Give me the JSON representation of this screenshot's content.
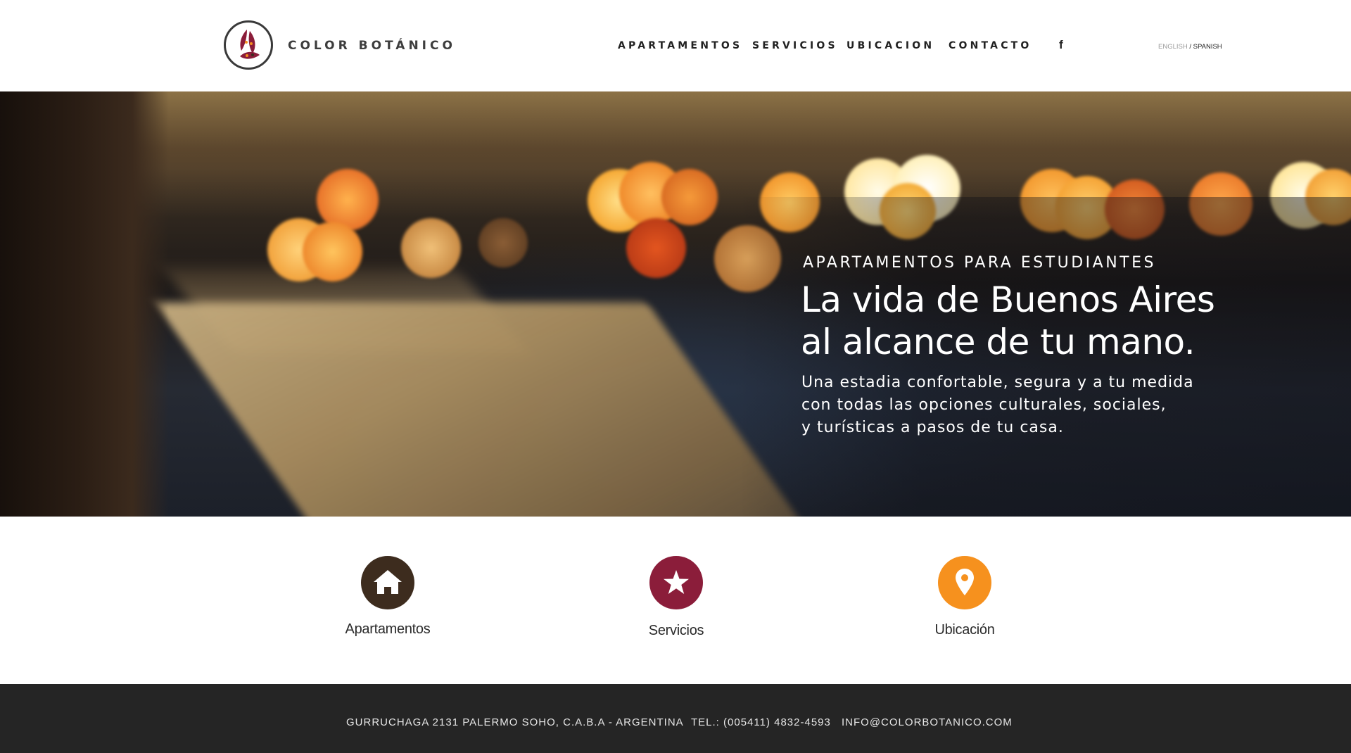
{
  "header": {
    "brand": "COLOR BOTÁNICO",
    "nav": [
      "APARTAMENTOS",
      "SERVICIOS",
      "UBICACION",
      "CONTACTO"
    ],
    "facebook_glyph": "f",
    "lang": {
      "english": "ENGLISH",
      "separator": " / ",
      "spanish": "SPANISH"
    }
  },
  "hero": {
    "eyebrow": "APARTAMENTOS PARA ESTUDIANTES",
    "title_lines": [
      "La vida de Buenos Aires",
      "al alcance de tu mano."
    ],
    "subtitle_lines": [
      "Una estadia confortable, segura y a tu medida",
      "con todas las opciones culturales, sociales,",
      "y turísticas a pasos de tu casa."
    ]
  },
  "features": [
    {
      "label": "Apartamentos",
      "icon": "home-icon",
      "color": "#3d2c1e"
    },
    {
      "label": "Servicios",
      "icon": "star-icon",
      "color": "#8b1d3a"
    },
    {
      "label": "Ubicación",
      "icon": "map-pin-icon",
      "color": "#f6911e"
    }
  ],
  "footer": {
    "address": "GURRUCHAGA 2131  PALERMO SOHO, C.A.B.A  - ARGENTINA",
    "phone": "TEL.: (005411) 4832-4593",
    "email": "INFO@COLORBOTANICO.COM"
  },
  "colors": {
    "brand_dark": "#3d2c1e",
    "brand_red": "#8b1d3a",
    "brand_orange": "#f6911e",
    "footer_bg": "#252525"
  }
}
